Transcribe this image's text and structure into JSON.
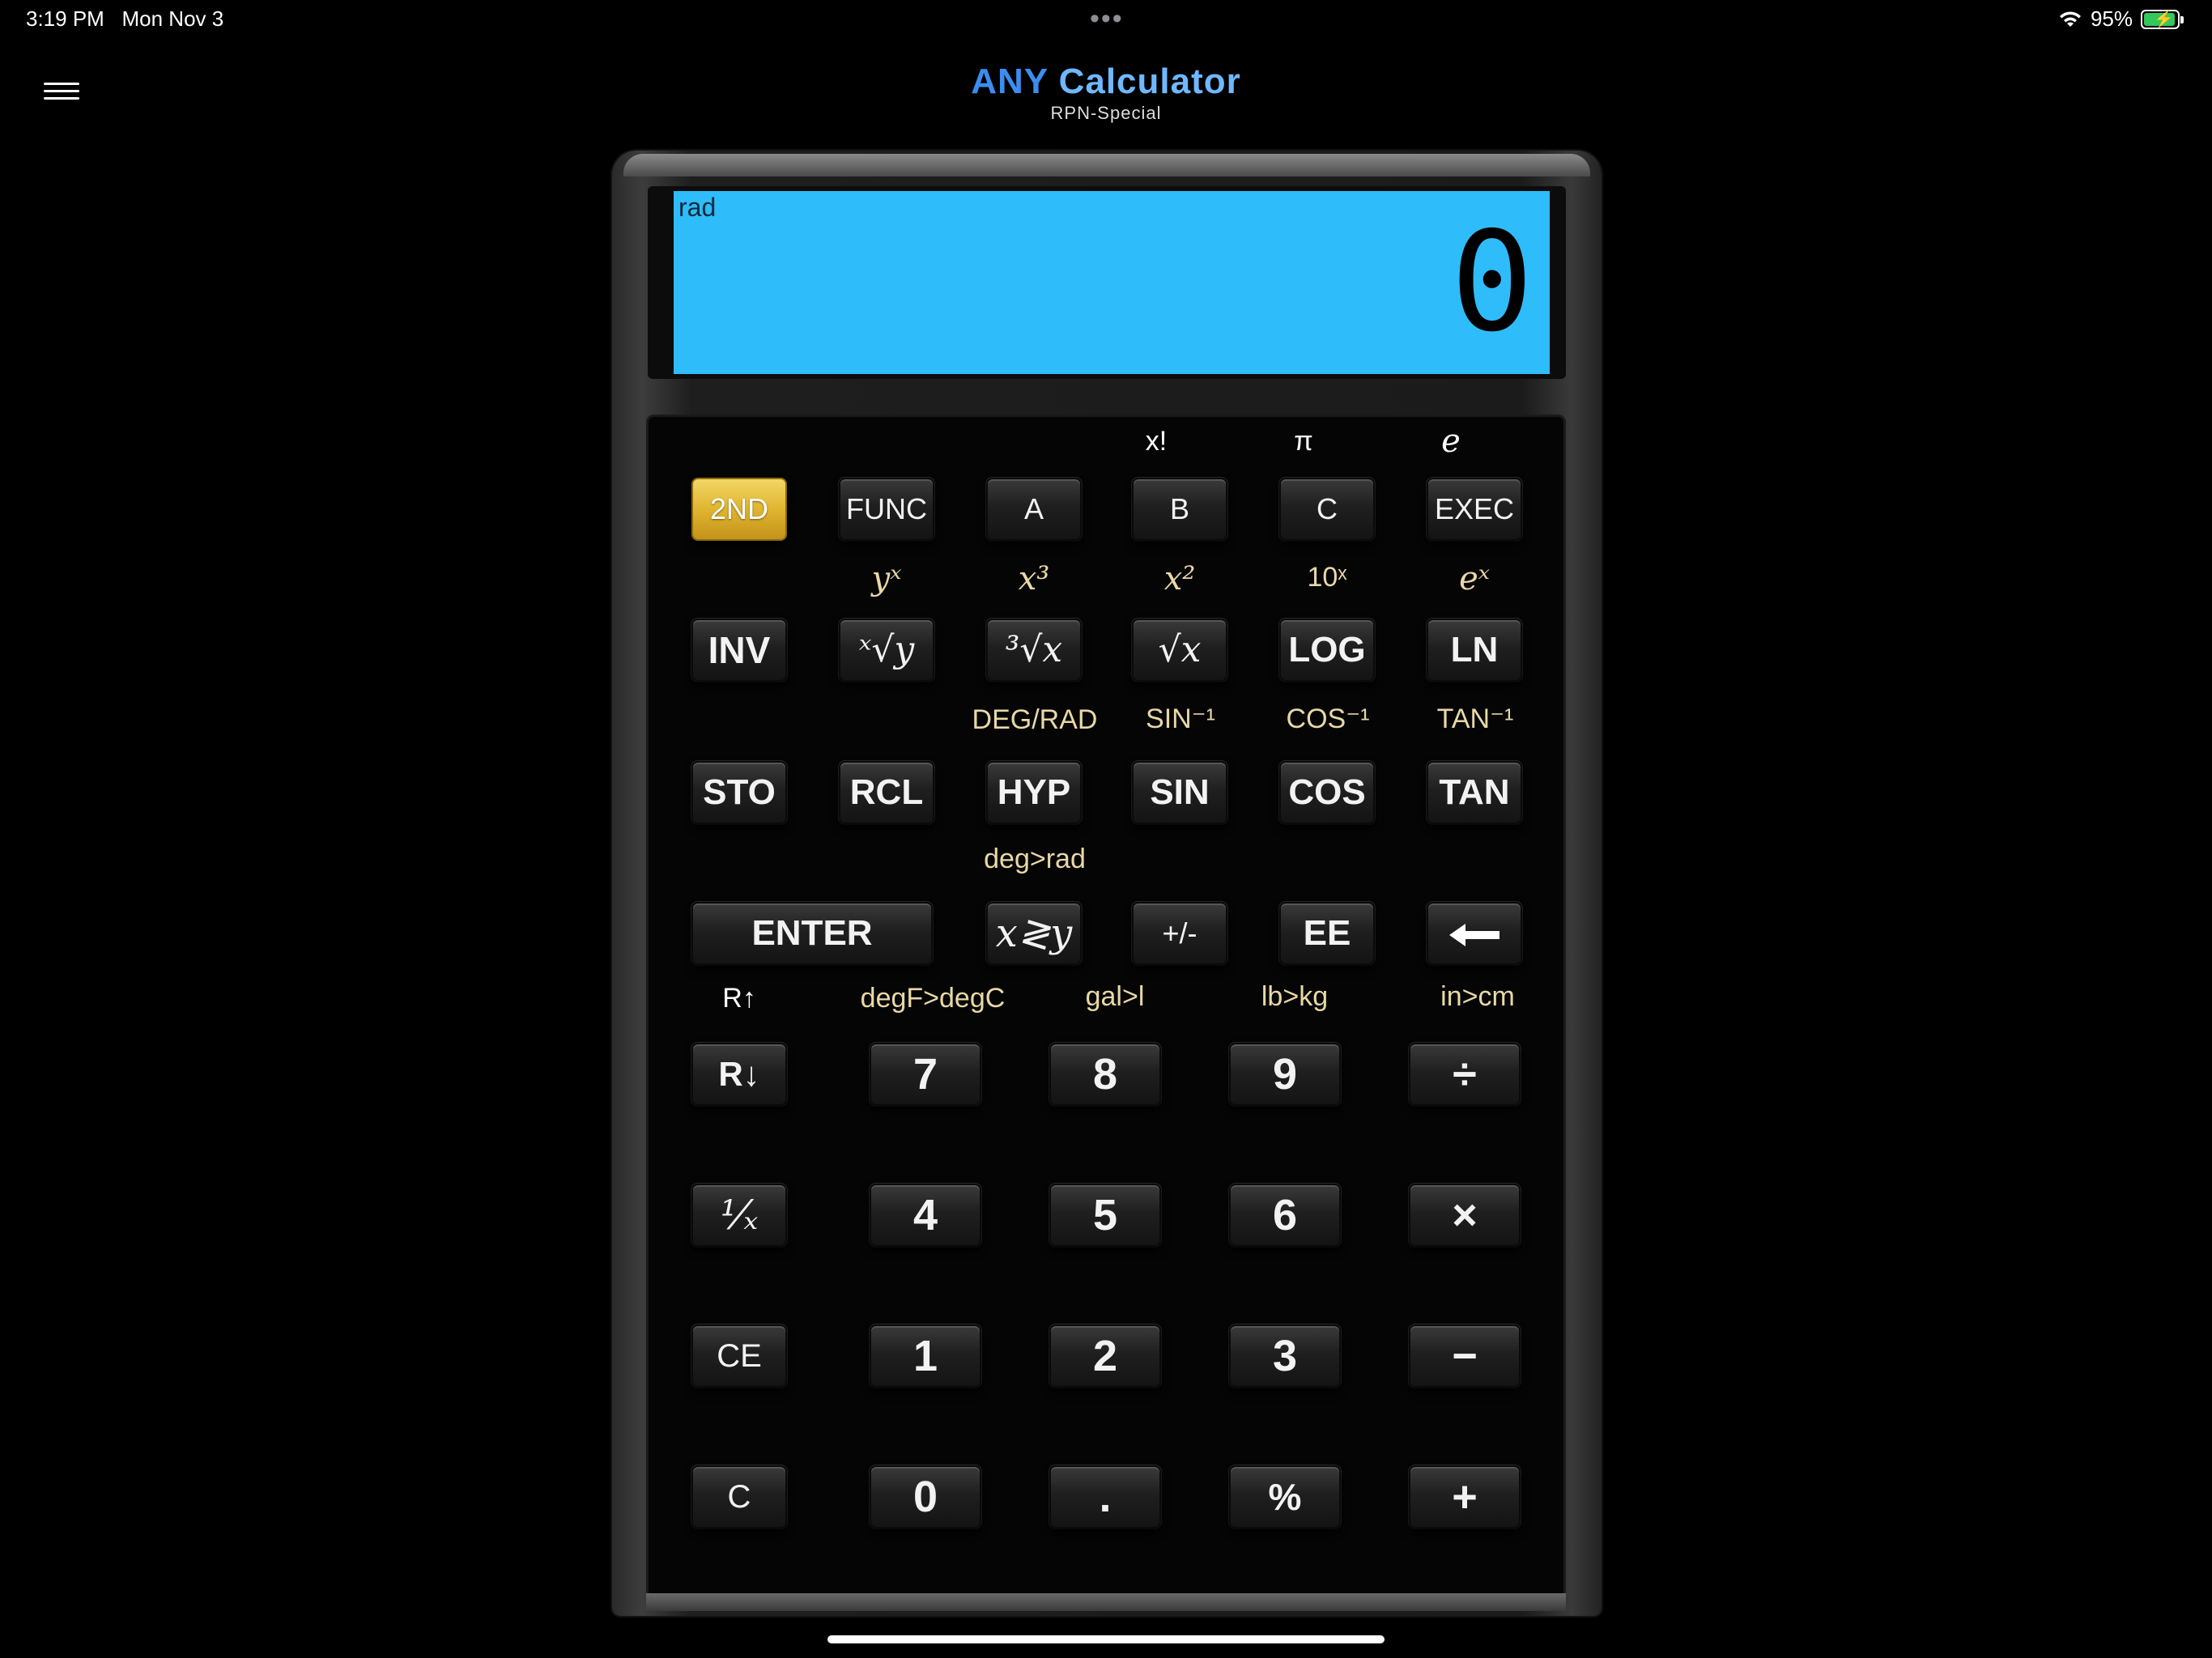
{
  "status_bar": {
    "time": "3:19 PM",
    "date": "Mon Nov 3",
    "dots": "•••",
    "battery": "95%"
  },
  "header": {
    "title_a": "ANY",
    "title_b": "Calculator",
    "subtitle": "RPN-Special"
  },
  "display": {
    "mode": "rad",
    "value": "0"
  },
  "colors": {
    "lcd": "#2fbcfa",
    "second_key": "#e0b52f",
    "title": "#3b8ef0",
    "secondary_label": "#e9d8a6"
  },
  "keys": {
    "r1": [
      "2ND",
      "FUNC",
      "A",
      "B",
      "C",
      "EXEC"
    ],
    "r1_sec": [
      "x!",
      "π",
      "e"
    ],
    "r2": [
      "INV",
      "ˣ√y",
      "³√x",
      "√x",
      "LOG",
      "LN"
    ],
    "r2_sec": [
      "yˣ",
      "x³",
      "x²",
      "10ˣ",
      "eˣ"
    ],
    "r3": [
      "STO",
      "RCL",
      "HYP",
      "SIN",
      "COS",
      "TAN"
    ],
    "r3_sec": [
      "DEG/RAD",
      "SIN⁻¹",
      "COS⁻¹",
      "TAN⁻¹"
    ],
    "r4": [
      "ENTER",
      "x≷y",
      "+/-",
      "EE",
      "🡐"
    ],
    "r4_sec": [
      "deg>rad"
    ],
    "r5": [
      "R↓",
      "7",
      "8",
      "9",
      "÷"
    ],
    "r5_sec": [
      "R↑",
      "degF>degC",
      "gal>l",
      "lb>kg",
      "in>cm"
    ],
    "r6": [
      "¹⁄ₓ",
      "4",
      "5",
      "6",
      "×"
    ],
    "r7": [
      "CE",
      "1",
      "2",
      "3",
      "−"
    ],
    "r8": [
      "C",
      "0",
      ".",
      "%",
      "+"
    ]
  }
}
